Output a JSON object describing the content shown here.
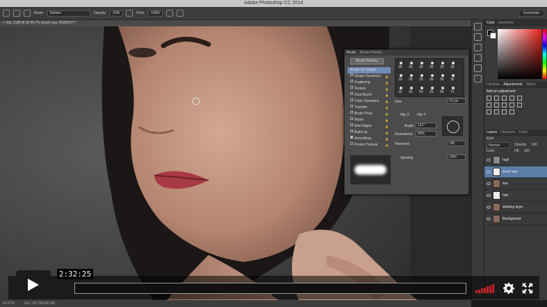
{
  "app": {
    "title": "Adobe Photoshop CC 2014",
    "options_bar": {
      "mode_label": "Mode:",
      "mode_value": "Darken",
      "opacity_label": "Opacity:",
      "opacity_value": "10%",
      "flow_label": "Flow:",
      "flow_value": "100%",
      "workspace": "Essentials"
    },
    "document_tab": "× Job_0180.tif @ 66.7% (touch ups, RGB/16*) *",
    "status": {
      "zoom": "66.67%",
      "doc": "Doc: 68.7M/145.3M"
    }
  },
  "brush_panel": {
    "tabs": [
      "Brush",
      "Brush Presets"
    ],
    "presets_button": "Brush Presets",
    "options": [
      {
        "label": "Brush Tip Shape",
        "selected": true
      },
      {
        "label": "Shape Dynamics"
      },
      {
        "label": "Scattering"
      },
      {
        "label": "Texture"
      },
      {
        "label": "Dual Brush"
      },
      {
        "label": "Color Dynamics"
      },
      {
        "label": "Transfer"
      },
      {
        "label": "Brush Pose"
      },
      {
        "label": "Noise"
      },
      {
        "label": "Wet Edges"
      },
      {
        "label": "Build-up"
      },
      {
        "label": "Smoothing",
        "checked": true
      },
      {
        "label": "Protect Texture"
      }
    ],
    "tip_sizes": [
      "30",
      "30",
      "30",
      "25",
      "25",
      "25",
      "25",
      "36",
      "25",
      "36",
      "36",
      "36",
      "32",
      "25",
      "50",
      "25",
      "50",
      "71"
    ],
    "size_label": "Size",
    "size_value": "51 px",
    "flip_x": "Flip X",
    "flip_y": "Flip Y",
    "angle_label": "Angle:",
    "angle_value": "121°",
    "roundness_label": "Roundness:",
    "roundness_value": "84%",
    "hardness_label": "Hardness",
    "hardness_value": "0%",
    "spacing_label": "Spacing",
    "spacing_value": "25%"
  },
  "right_panel": {
    "color_tabs": [
      "Color",
      "Swatches"
    ],
    "adj_tabs": [
      "Libraries",
      "Adjustments",
      "Styles"
    ],
    "adj_title": "Add an adjustment",
    "layers_tabs": [
      "Layers",
      "Channels",
      "Paths"
    ],
    "kind_label": "Kind",
    "blend_mode": "Normal",
    "opacity_label": "Opacity:",
    "opacity_value": "100",
    "lock_label": "Lock:",
    "fill_label": "Fill:",
    "fill_value": "100",
    "layers": [
      {
        "name": "high",
        "thumb": "gray"
      },
      {
        "name": "touch ups",
        "thumb": "white",
        "selected": true
      },
      {
        "name": "low",
        "thumb": "photo"
      },
      {
        "name": "hair",
        "thumb": "white"
      },
      {
        "name": "working layer",
        "thumb": "photo"
      },
      {
        "name": "Background",
        "thumb": "photo"
      }
    ]
  },
  "player": {
    "timestamp": "2:32:25",
    "progress": 0.0,
    "volume_level": 1.0,
    "accent_color": "#c42025"
  }
}
